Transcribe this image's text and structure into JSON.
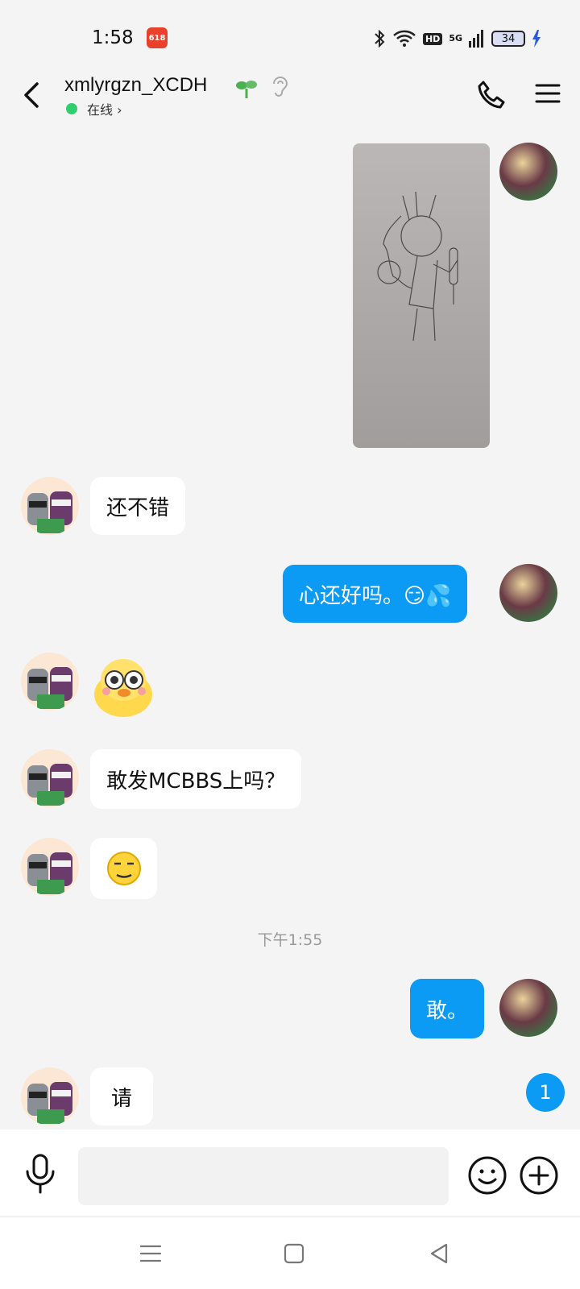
{
  "status_bar": {
    "time": "1:58",
    "badge": "618",
    "network": "5G",
    "hd": "HD",
    "battery": "34"
  },
  "header": {
    "name": "xmlyrgzn_XCDH",
    "status": "在线",
    "status_chevron": "›"
  },
  "messages": {
    "m1": "还不错",
    "m2": "心还好吗。😏💦",
    "m4": "敢发MCBBS上吗？",
    "m6": "敢。",
    "m7": "请"
  },
  "timestamp": "下午1:55",
  "unread_count": "1",
  "input": {
    "placeholder": ""
  },
  "colors": {
    "accent": "#0b9af4",
    "online": "#2fcf6d"
  }
}
